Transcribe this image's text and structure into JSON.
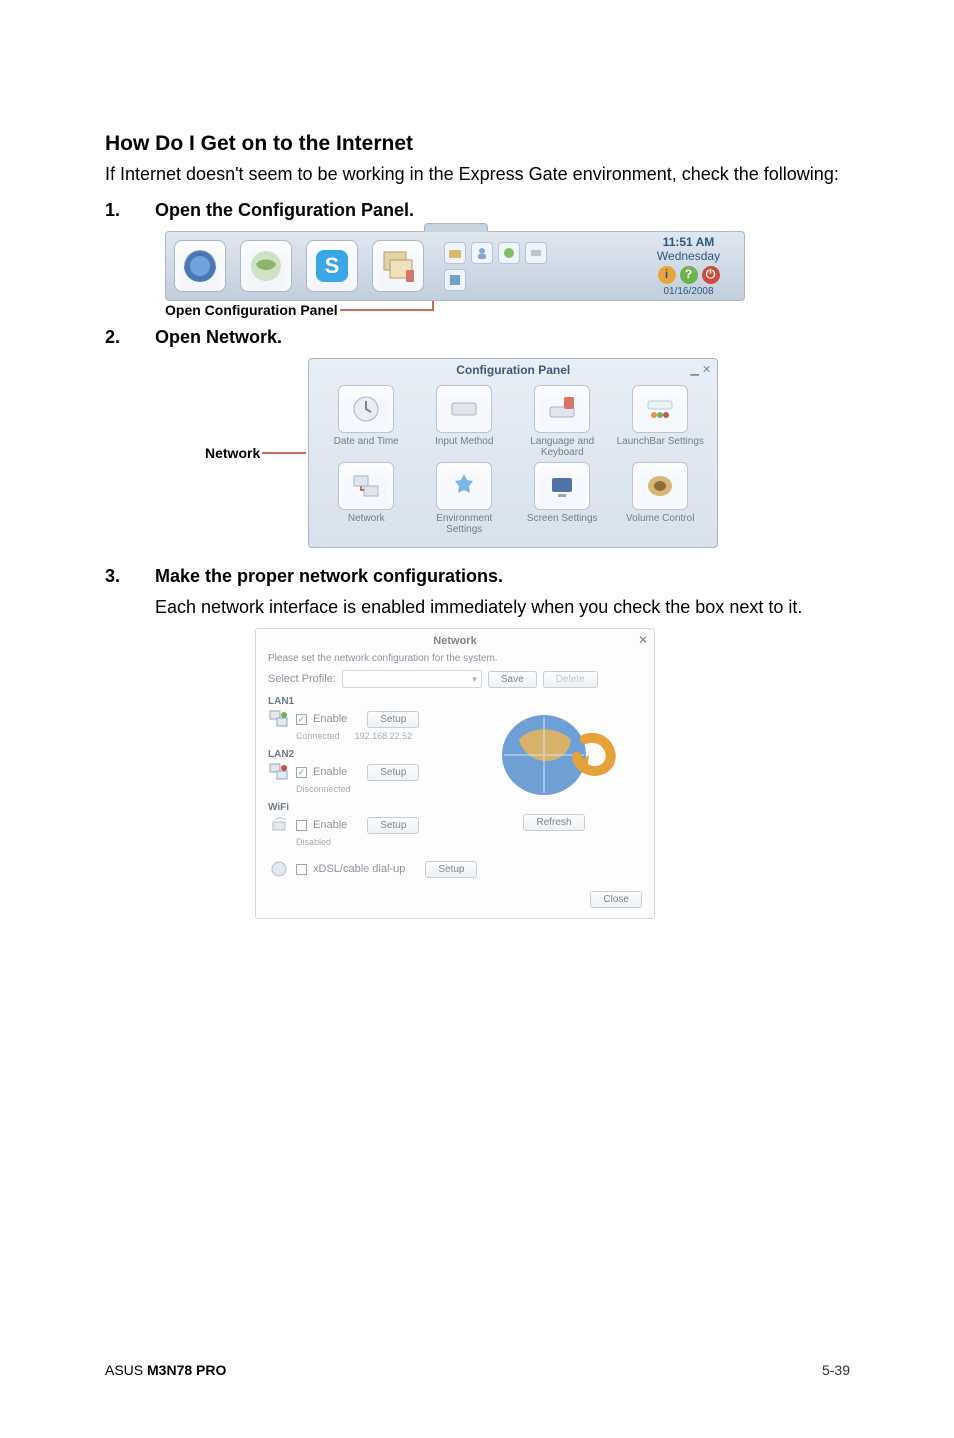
{
  "heading": "How Do I Get on to the Internet",
  "intro": "If Internet doesn't seem to be working in the Express Gate environment, check the following:",
  "step1": {
    "num": "1.",
    "text": "Open the Configuration Panel."
  },
  "step2": {
    "num": "2.",
    "text": "Open Network."
  },
  "step3": {
    "num": "3.",
    "text": "Make the proper network configurations.",
    "desc": "Each network interface is enabled immediately when you check the box next to it."
  },
  "taskbar": {
    "caption": "Open Configuration Panel",
    "clock": {
      "time": "11:51 AM",
      "day": "Wednesday",
      "date": "01/16/2008"
    }
  },
  "configPanel": {
    "title": "Configuration Panel",
    "sideLabel": "Network",
    "items": [
      {
        "label": "Date and Time"
      },
      {
        "label": "Input Method"
      },
      {
        "label": "Language and Keyboard"
      },
      {
        "label": "LaunchBar Settings"
      },
      {
        "label": "Network"
      },
      {
        "label": "Environment Settings"
      },
      {
        "label": "Screen Settings"
      },
      {
        "label": "Volume Control"
      }
    ]
  },
  "network": {
    "title": "Network",
    "subtitle": "Please set the network configuration for the system.",
    "selectProfileLabel": "Select Profile:",
    "saveLabel": "Save",
    "deleteLabel": "Delete",
    "ifaces": {
      "lan1": {
        "title": "LAN1",
        "enable": "Enable",
        "setup": "Setup",
        "status": "Connected",
        "ip": "192.168.22.52"
      },
      "lan2": {
        "title": "LAN2",
        "enable": "Enable",
        "setup": "Setup",
        "status": "Disconnected"
      },
      "wifi": {
        "title": "WiFi",
        "enable": "Enable",
        "setup": "Setup",
        "status": "Disabled"
      }
    },
    "dialup": {
      "label": "xDSL/cable dial-up",
      "setup": "Setup"
    },
    "refresh": "Refresh",
    "close": "Close"
  },
  "footer": {
    "left": "ASUS M3N78 PRO",
    "right": "5-39"
  }
}
